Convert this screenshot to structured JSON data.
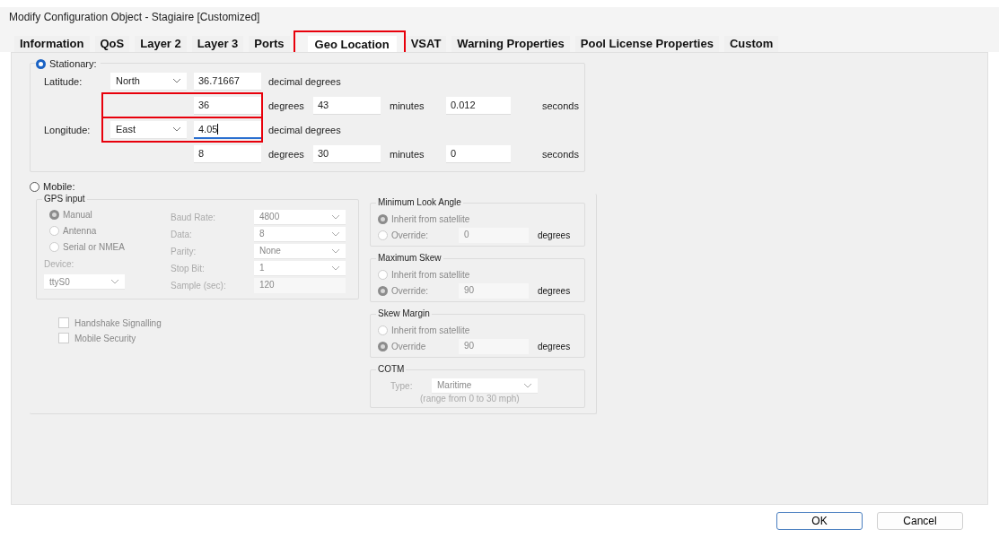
{
  "window": {
    "title": "Modify Configuration Object - Stagiaire [Customized]"
  },
  "tabs": [
    {
      "label": "Information",
      "selected": false,
      "highlighted": false
    },
    {
      "label": "QoS",
      "selected": false,
      "highlighted": false
    },
    {
      "label": "Layer 2",
      "selected": false,
      "highlighted": false
    },
    {
      "label": "Layer 3",
      "selected": false,
      "highlighted": false
    },
    {
      "label": "Ports",
      "selected": false,
      "highlighted": false
    },
    {
      "label": "Geo Location",
      "selected": true,
      "highlighted": true
    },
    {
      "label": "VSAT",
      "selected": false,
      "highlighted": false
    },
    {
      "label": "Warning Properties",
      "selected": false,
      "highlighted": false
    },
    {
      "label": "Pool License Properties",
      "selected": false,
      "highlighted": false
    },
    {
      "label": "Custom",
      "selected": false,
      "highlighted": false
    }
  ],
  "stationary": {
    "label": "Stationary:",
    "selected": true,
    "coordinates": [
      {
        "label": "Latitude:",
        "hemisphere": "North",
        "decimal": "36.71667",
        "decimal_unit": "decimal degrees",
        "decimal_focused": false,
        "decimal_highlighted": false,
        "degrees": "36",
        "degrees_unit": "degrees",
        "minutes": "43",
        "minutes_unit": "minutes",
        "seconds": "0.012",
        "seconds_unit": "seconds",
        "dms_highlighted": true
      },
      {
        "label": "Longitude:",
        "hemisphere": "East",
        "decimal": "4.05",
        "decimal_unit": "decimal degrees",
        "decimal_focused": true,
        "decimal_highlighted": true,
        "degrees": "8",
        "degrees_unit": "degrees",
        "minutes": "30",
        "minutes_unit": "minutes",
        "seconds": "0",
        "seconds_unit": "seconds",
        "dms_highlighted": false
      }
    ]
  },
  "mobile": {
    "label": "Mobile:",
    "selected": false,
    "disabled": true,
    "gps_input": {
      "title": "GPS input",
      "sources": [
        {
          "label": "Manual",
          "selected": true
        },
        {
          "label": "Antenna",
          "selected": false
        },
        {
          "label": "Serial or NMEA",
          "selected": false
        }
      ],
      "device_label": "Device:",
      "device": "ttyS0",
      "settings": [
        {
          "label": "Baud Rate:",
          "value": "4800",
          "kind": "select"
        },
        {
          "label": "Data:",
          "value": "8",
          "kind": "select"
        },
        {
          "label": "Parity:",
          "value": "None",
          "kind": "select"
        },
        {
          "label": "Stop Bit:",
          "value": "1",
          "kind": "select"
        },
        {
          "label": "Sample (sec):",
          "value": "120",
          "kind": "text"
        }
      ]
    },
    "checkboxes": [
      {
        "label": "Handshake Signalling",
        "checked": false
      },
      {
        "label": "Mobile Security",
        "checked": false
      }
    ],
    "angle_groups": [
      {
        "title": "Minimum Look Angle",
        "options": [
          {
            "label": "Inherit from satellite",
            "selected": true
          },
          {
            "label": "Override:",
            "selected": false
          }
        ],
        "value": "0",
        "unit": "degrees"
      },
      {
        "title": "Maximum Skew",
        "options": [
          {
            "label": "Inherit from satellite",
            "selected": false
          },
          {
            "label": "Override:",
            "selected": true
          }
        ],
        "value": "90",
        "unit": "degrees"
      },
      {
        "title": "Skew Margin",
        "options": [
          {
            "label": "Inherit from satellite",
            "selected": false
          },
          {
            "label": "Override",
            "selected": true
          }
        ],
        "value": "90",
        "unit": "degrees"
      }
    ],
    "cotm": {
      "title": "COTM",
      "type_label": "Type:",
      "type": "Maritime",
      "note": "(range from 0 to 30 mph)"
    }
  },
  "buttons": [
    {
      "label": "OK",
      "default": true
    },
    {
      "label": "Cancel",
      "default": false
    }
  ]
}
